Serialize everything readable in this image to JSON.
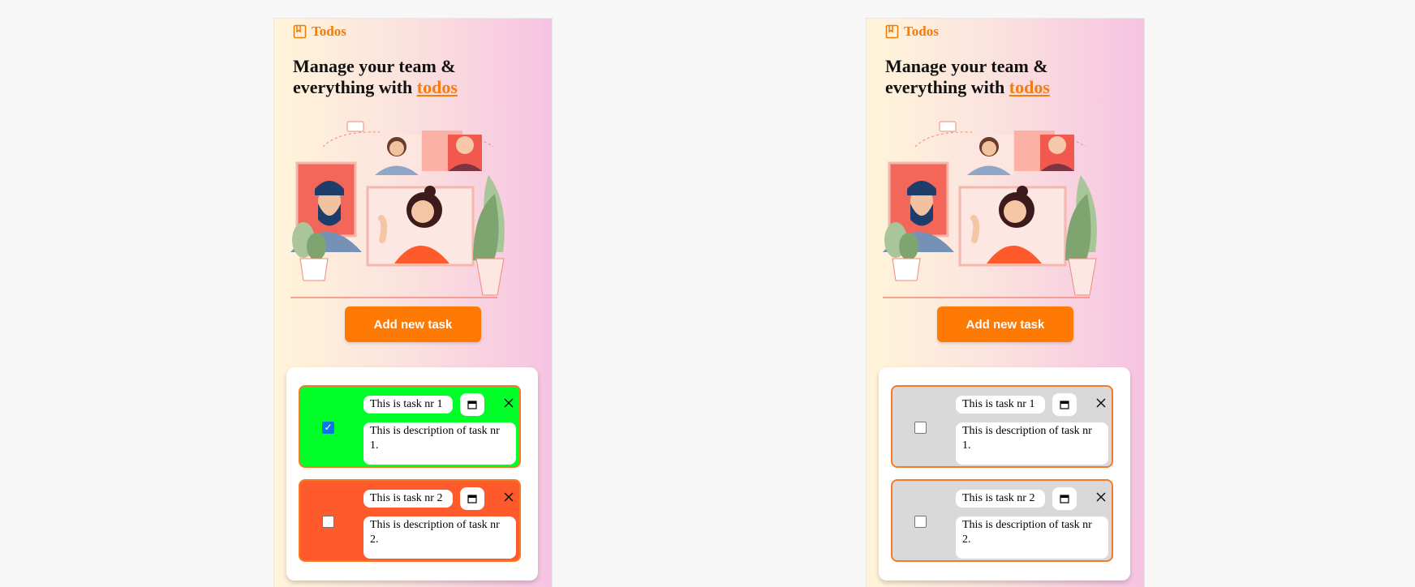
{
  "brand": {
    "name": "Todos",
    "accent": "#f27c0a",
    "icon": "book-icon"
  },
  "headline": {
    "lead": "Manage your team & everything with ",
    "link": "todos"
  },
  "illustration": {
    "description_icon": "team-video-call-illustration"
  },
  "add_button": {
    "label": "Add new task",
    "color": "#ff7a05"
  },
  "left_panel": {
    "tasks": [
      {
        "title": "This is task nr 1",
        "description": "This is description of task nr 1.",
        "checked": true,
        "color": "#00ff29"
      },
      {
        "title": "This is task nr 2",
        "description": "This is description of task nr 2.",
        "checked": false,
        "color": "#ff5a2b"
      }
    ]
  },
  "right_panel": {
    "tasks": [
      {
        "title": "This is task nr 1",
        "description": "This is description of task nr 1.",
        "checked": false,
        "color": "#d9d9d9"
      },
      {
        "title": "This is task nr 2",
        "description": "This is description of task nr 2.",
        "checked": false,
        "color": "#d9d9d9"
      }
    ]
  }
}
